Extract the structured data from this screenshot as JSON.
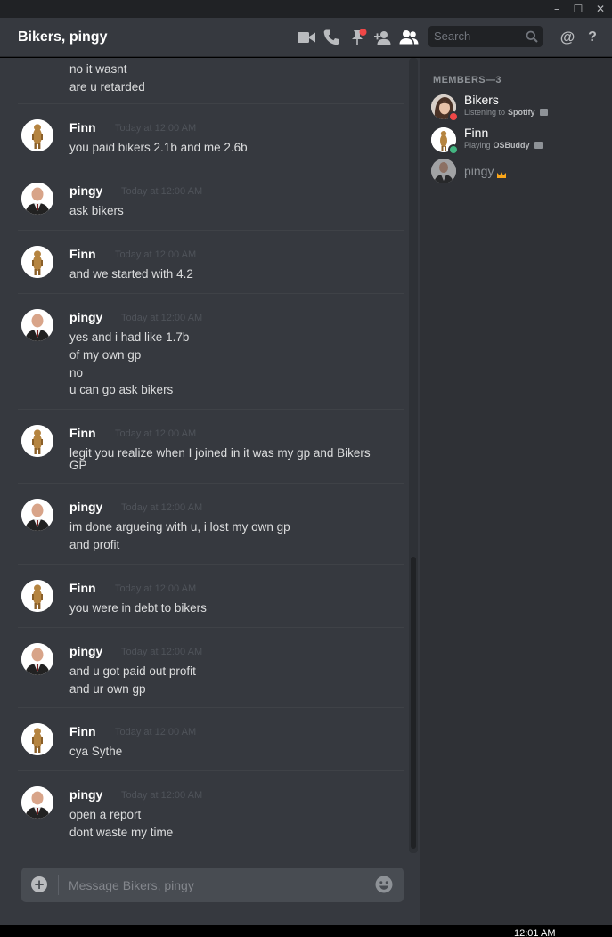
{
  "window": {
    "minimize_glyph": "–",
    "maximize_glyph": "☐",
    "close_glyph": "✕"
  },
  "header": {
    "title": "Bikers, pingy",
    "icons": [
      "video-call-icon",
      "voice-call-icon",
      "pinned-messages-icon",
      "add-friend-icon",
      "member-list-icon"
    ],
    "search_placeholder": "Search",
    "mention_glyph": "@",
    "help_glyph": "?"
  },
  "messages": [
    {
      "author": "",
      "timestamp": "",
      "avatar": "",
      "lines": [
        "no it wasnt",
        "are u retarded"
      ]
    },
    {
      "author": "Finn",
      "timestamp": "Today at 12:00 AM",
      "avatar": "finn",
      "lines": [
        "you paid bikers 2.1b and me 2.6b"
      ]
    },
    {
      "author": "pingy",
      "timestamp": "Today at 12:00 AM",
      "avatar": "pingy",
      "lines": [
        "ask bikers"
      ]
    },
    {
      "author": "Finn",
      "timestamp": "Today at 12:00 AM",
      "avatar": "finn",
      "lines": [
        "and we started with 4.2"
      ]
    },
    {
      "author": "pingy",
      "timestamp": "Today at 12:00 AM",
      "avatar": "pingy",
      "lines": [
        "yes and i had like 1.7b",
        "of my own gp",
        "no",
        "u can go ask bikers"
      ]
    },
    {
      "author": "Finn",
      "timestamp": "Today at 12:00 AM",
      "avatar": "finn",
      "lines": [
        "legit you realize when I joined in it was my gp and Bikers GP"
      ]
    },
    {
      "author": "pingy",
      "timestamp": "Today at 12:00 AM",
      "avatar": "pingy",
      "lines": [
        "im done  argueing with u, i lost my own gp",
        "and profit"
      ]
    },
    {
      "author": "Finn",
      "timestamp": "Today at 12:00 AM",
      "avatar": "finn",
      "lines": [
        "you were in debt to bikers"
      ]
    },
    {
      "author": "pingy",
      "timestamp": "Today at 12:00 AM",
      "avatar": "pingy",
      "lines": [
        "and u got paid out profit",
        "and ur own gp"
      ]
    },
    {
      "author": "Finn",
      "timestamp": "Today at 12:00 AM",
      "avatar": "finn",
      "lines": [
        "cya Sythe"
      ]
    },
    {
      "author": "pingy",
      "timestamp": "Today at 12:00 AM",
      "avatar": "pingy",
      "lines": [
        "open a report",
        "dont waste my time"
      ]
    }
  ],
  "composer": {
    "placeholder": "Message Bikers, pingy",
    "attach_glyph": "+"
  },
  "members": {
    "header": "MEMBERS—3",
    "list": [
      {
        "name": "Bikers",
        "activity_prefix": "Listening to",
        "activity_name": "Spotify",
        "status": "dnd",
        "status_color": "#f04747"
      },
      {
        "name": "Finn",
        "activity_prefix": "Playing",
        "activity_name": "OSBuddy",
        "status": "online",
        "status_color": "#43b581"
      },
      {
        "name": "pingy",
        "activity_prefix": "",
        "activity_name": "",
        "status": "offline",
        "owner": true
      }
    ]
  },
  "taskbar": {
    "clock": "12:01 AM"
  },
  "colors": {
    "chat_bg": "#36393f",
    "sidebar_bg": "#2f3136",
    "titlebar_bg": "#202225",
    "text_primary": "#dcddde",
    "timestamp": "#4f535a",
    "crown": "#faa61a",
    "notify_red": "#f04747"
  }
}
